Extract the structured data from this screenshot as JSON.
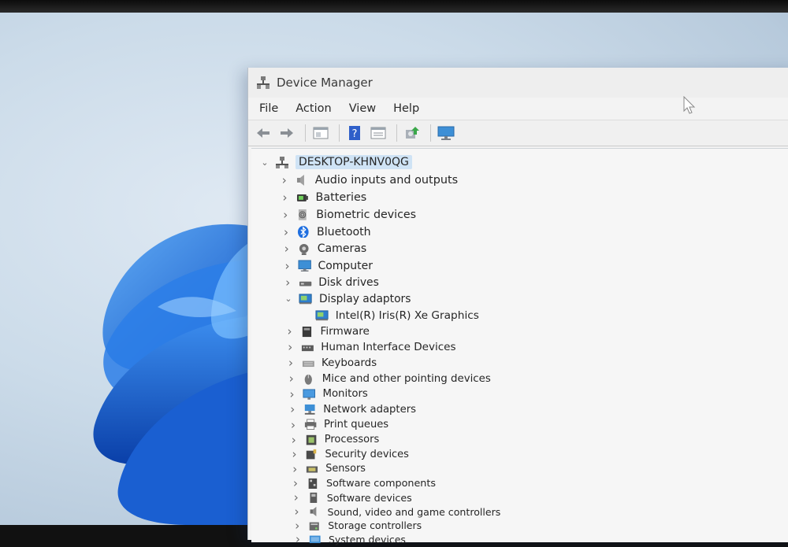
{
  "window": {
    "title": "Device Manager"
  },
  "menu": [
    "File",
    "Action",
    "View",
    "Help"
  ],
  "toolbar": [
    "back-icon",
    "forward-icon",
    "properties-icon",
    "help-icon",
    "details-icon",
    "update-driver-icon",
    "monitor-icon"
  ],
  "tree": {
    "root": "DESKTOP-KHNV0QG",
    "items": [
      {
        "label": "Audio inputs and outputs",
        "icon": "speaker-icon",
        "expanded": false
      },
      {
        "label": "Batteries",
        "icon": "battery-icon",
        "expanded": false
      },
      {
        "label": "Biometric devices",
        "icon": "fingerprint-icon",
        "expanded": false
      },
      {
        "label": "Bluetooth",
        "icon": "bluetooth-icon",
        "expanded": false
      },
      {
        "label": "Cameras",
        "icon": "camera-icon",
        "expanded": false
      },
      {
        "label": "Computer",
        "icon": "computer-icon",
        "expanded": false
      },
      {
        "label": "Disk drives",
        "icon": "disk-drive-icon",
        "expanded": false
      },
      {
        "label": "Display adaptors",
        "icon": "display-adapter-icon",
        "expanded": true,
        "children": [
          {
            "label": "Intel(R) Iris(R) Xe Graphics",
            "icon": "display-adapter-icon"
          }
        ]
      },
      {
        "label": "Firmware",
        "icon": "firmware-icon",
        "expanded": false
      },
      {
        "label": "Human Interface Devices",
        "icon": "hid-icon",
        "expanded": false
      },
      {
        "label": "Keyboards",
        "icon": "keyboard-icon",
        "expanded": false
      },
      {
        "label": "Mice and other pointing devices",
        "icon": "mouse-icon",
        "expanded": false
      },
      {
        "label": "Monitors",
        "icon": "monitor-icon",
        "expanded": false
      },
      {
        "label": "Network adapters",
        "icon": "network-icon",
        "expanded": false
      },
      {
        "label": "Print queues",
        "icon": "printer-icon",
        "expanded": false
      },
      {
        "label": "Processors",
        "icon": "processor-icon",
        "expanded": false
      },
      {
        "label": "Security devices",
        "icon": "security-icon",
        "expanded": false
      },
      {
        "label": "Sensors",
        "icon": "sensor-icon",
        "expanded": false
      },
      {
        "label": "Software components",
        "icon": "software-component-icon",
        "expanded": false
      },
      {
        "label": "Software devices",
        "icon": "software-device-icon",
        "expanded": false
      },
      {
        "label": "Sound, video and game controllers",
        "icon": "sound-icon",
        "expanded": false
      },
      {
        "label": "Storage controllers",
        "icon": "storage-icon",
        "expanded": false
      },
      {
        "label": "System devices",
        "icon": "system-icon",
        "expanded": false
      }
    ]
  },
  "colors": {
    "selection": "#cfe3f5",
    "bloom": "#1e6fd9",
    "window_bg": "#f3f3f3"
  }
}
